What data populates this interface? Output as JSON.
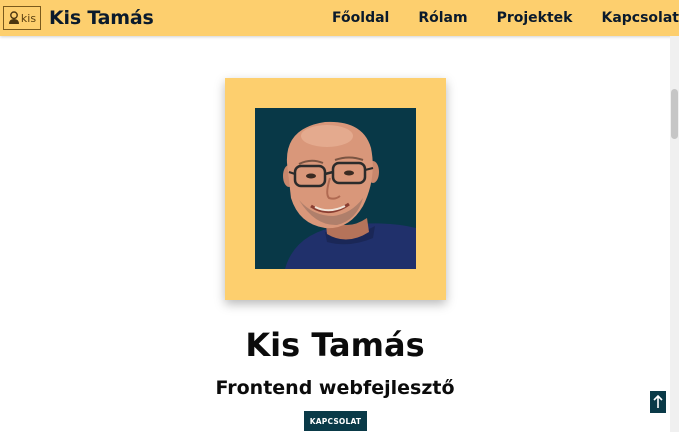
{
  "header": {
    "logo_text": "kis",
    "brand_name": "Kis Tamás",
    "nav": [
      "Főoldal",
      "Rólam",
      "Projektek",
      "Kapcsolat"
    ]
  },
  "hero": {
    "name": "Kis Tamás",
    "subtitle": "Frontend webfejlesztő",
    "button_label": "KAPCSOLAT"
  },
  "colors": {
    "accent": "#fdcf6e",
    "dark": "#0a3a48",
    "photo_background": "#083847"
  },
  "icons": {
    "logo": "person-icon",
    "back_to_top": "arrow-up-icon"
  }
}
